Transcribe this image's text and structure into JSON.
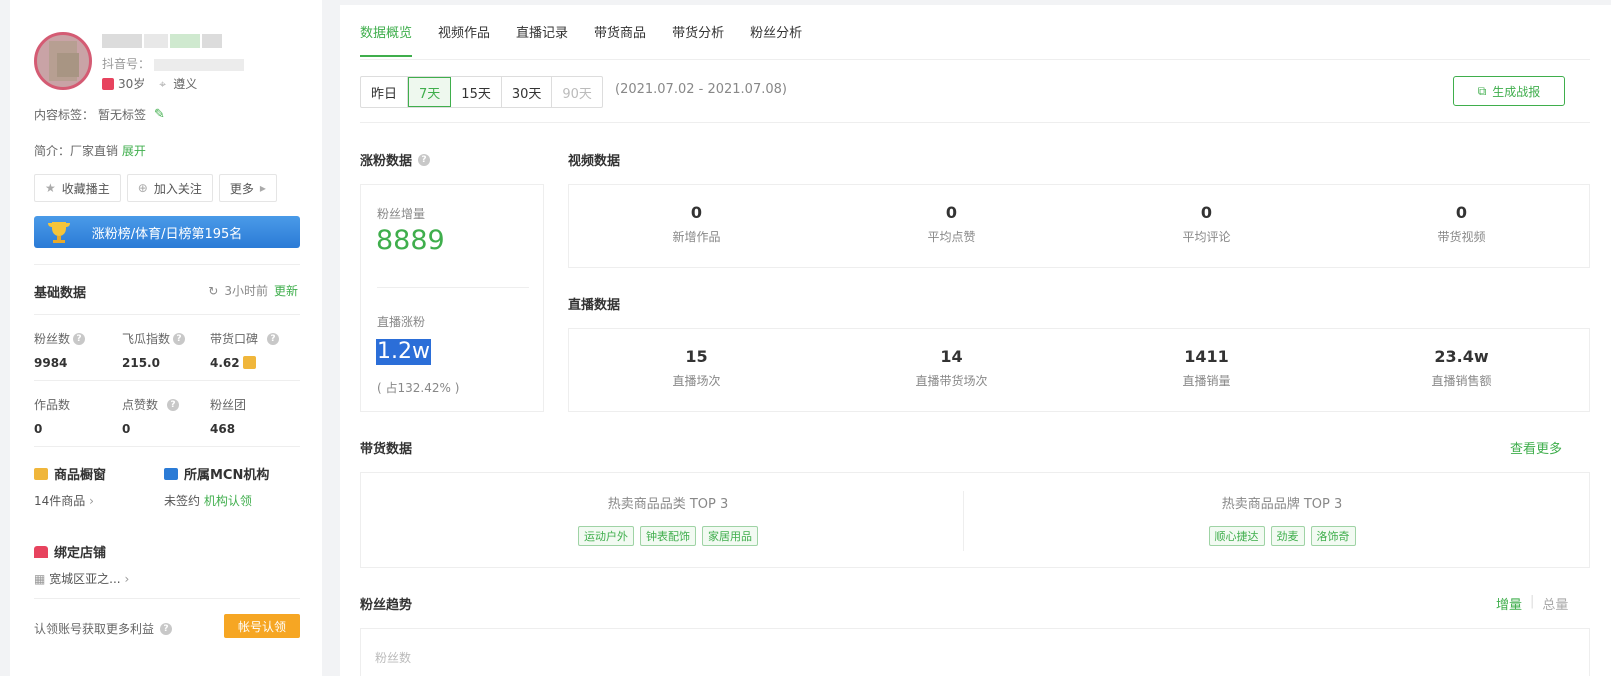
{
  "profile": {
    "douyin_label": "抖音号：",
    "age": "30岁",
    "location": "遵义",
    "content_tag_label": "内容标签：",
    "content_tag_value": "暂无标签",
    "intro_label": "简介：",
    "intro_value": "厂家直销",
    "intro_expand": "展开"
  },
  "actions": {
    "favorite": "收藏播主",
    "follow": "加入关注",
    "more": "更多"
  },
  "rank_banner": "涨粉榜/体育/日榜第195名",
  "basic": {
    "title": "基础数据",
    "updated": "3小时前",
    "update_link": "更新",
    "stats": [
      {
        "label": "粉丝数",
        "value": "9984"
      },
      {
        "label": "飞瓜指数",
        "value": "215.0"
      },
      {
        "label": "带货口碑",
        "value": "4.62"
      },
      {
        "label": "作品数",
        "value": "0"
      },
      {
        "label": "点赞数",
        "value": "0"
      },
      {
        "label": "粉丝团",
        "value": "468"
      }
    ]
  },
  "showcase": {
    "title": "商品橱窗",
    "value": "14件商品"
  },
  "mcn": {
    "title": "所属MCN机构",
    "value": "未签约",
    "link": "机构认领"
  },
  "store": {
    "title": "绑定店铺",
    "value": "宽城区亚之..."
  },
  "claim": {
    "text": "认领账号获取更多利益",
    "button": "帐号认领"
  },
  "tabs": [
    "数据概览",
    "视频作品",
    "直播记录",
    "带货商品",
    "带货分析",
    "粉丝分析"
  ],
  "range_buttons": [
    "昨日",
    "7天",
    "15天",
    "30天",
    "90天"
  ],
  "date_range": "(2021.07.02 - 2021.07.08)",
  "report_button": "生成战报",
  "fans_growth": {
    "title": "涨粉数据",
    "increase_label": "粉丝增量",
    "increase_value": "8889",
    "live_label": "直播涨粉",
    "live_value": "1.2w",
    "live_ratio": "( 占132.42% )"
  },
  "video_data": {
    "title": "视频数据",
    "metrics": [
      {
        "value": "0",
        "label": "新增作品"
      },
      {
        "value": "0",
        "label": "平均点赞"
      },
      {
        "value": "0",
        "label": "平均评论"
      },
      {
        "value": "0",
        "label": "带货视频"
      }
    ]
  },
  "live_data": {
    "title": "直播数据",
    "metrics": [
      {
        "value": "15",
        "label": "直播场次"
      },
      {
        "value": "14",
        "label": "直播带货场次"
      },
      {
        "value": "1411",
        "label": "直播销量"
      },
      {
        "value": "23.4w",
        "label": "直播销售额"
      }
    ]
  },
  "goods": {
    "title": "带货数据",
    "more": "查看更多",
    "categories_title": "热卖商品品类 TOP 3",
    "categories": [
      "运动户外",
      "钟表配饰",
      "家居用品"
    ],
    "brands_title": "热卖商品品牌 TOP 3",
    "brands": [
      "顺心捷达",
      "劲麦",
      "洛饰奇"
    ]
  },
  "trend": {
    "title": "粉丝趋势",
    "increase": "增量",
    "total": "总量",
    "axis_label": "粉丝数"
  },
  "colors": {
    "accent": "#3fae4c",
    "banner": "#2b7bd6",
    "claim": "#f6a623"
  }
}
